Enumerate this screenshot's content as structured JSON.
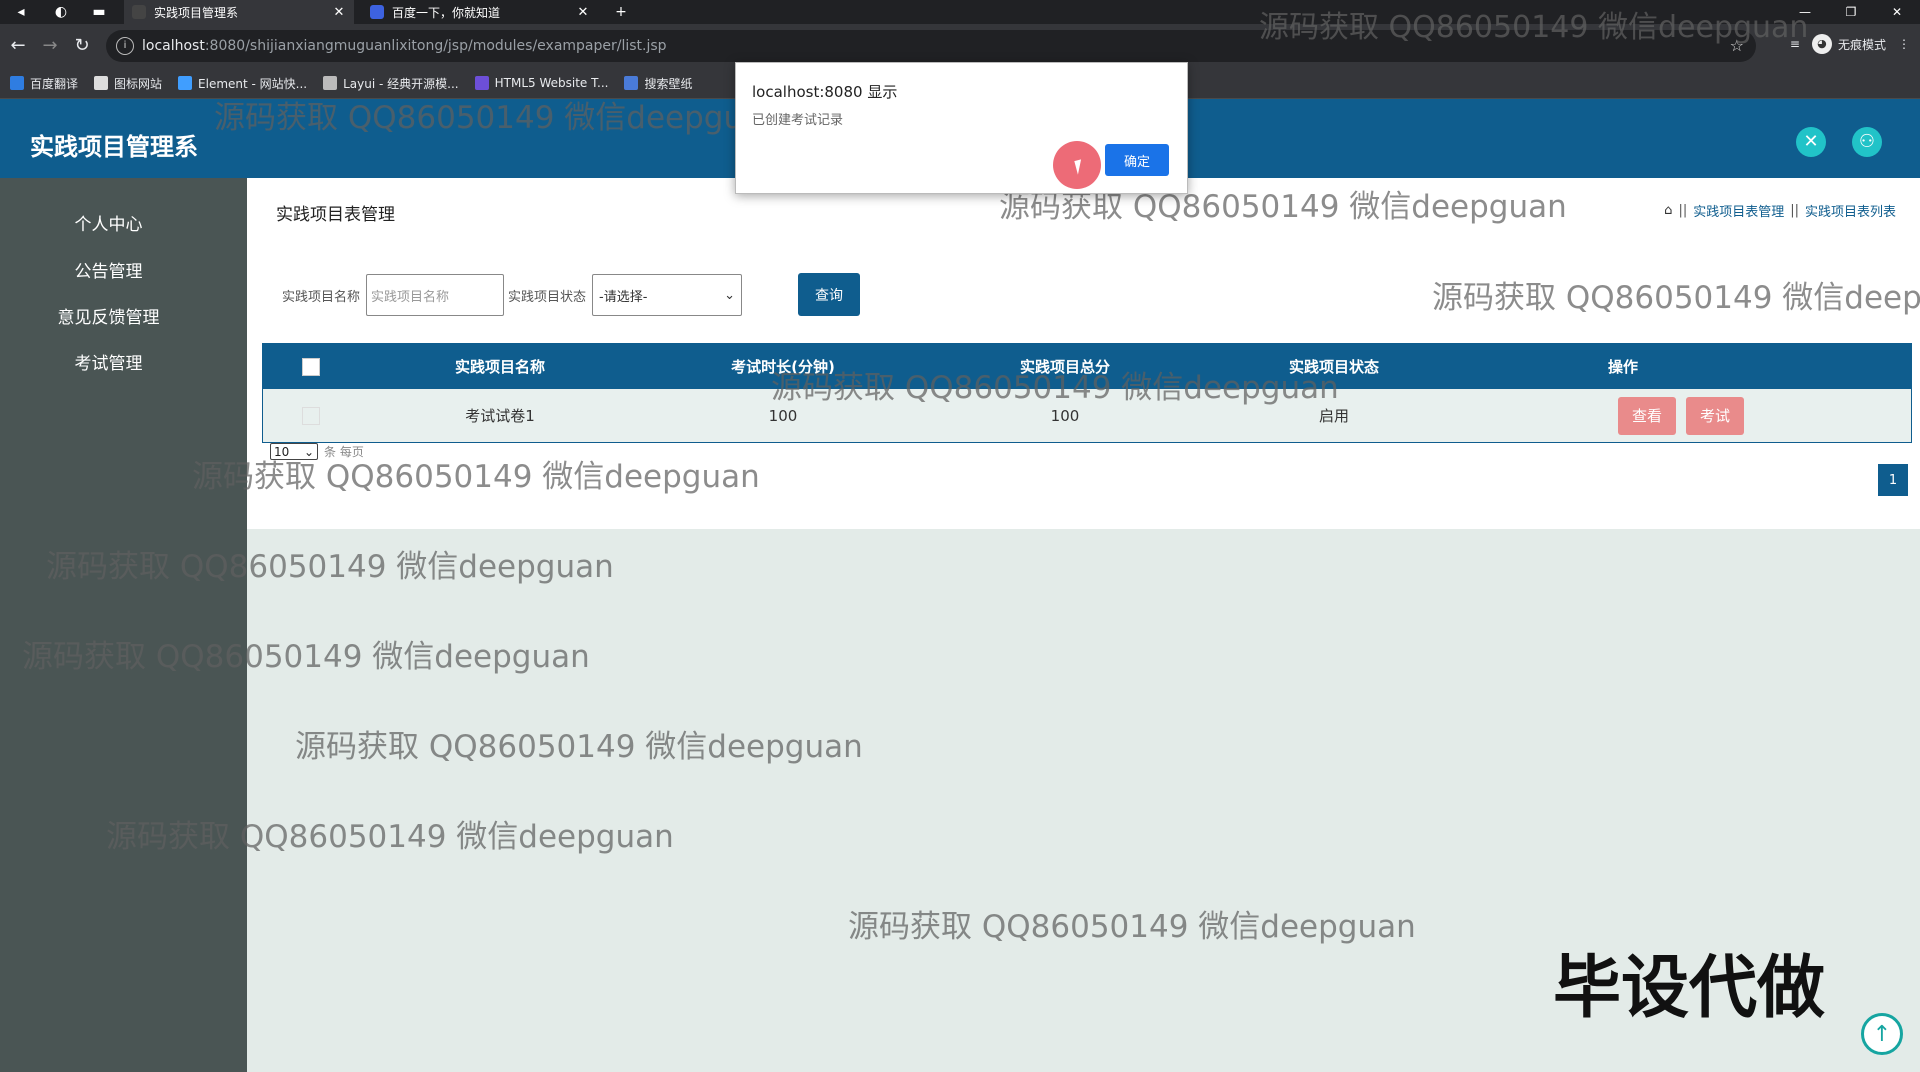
{
  "browser": {
    "tabs": [
      {
        "title": "实践项目管理系",
        "active": true
      },
      {
        "title": "百度一下，你就知道",
        "active": false
      }
    ],
    "url_host": "localhost",
    "url_path": ":8080/shijianxiangmuguanlixitong/jsp/modules/exampaper/list.jsp",
    "incognito_label": "无痕模式",
    "bookmarks": [
      "百度翻译",
      "图标网站",
      "Element - 网站快...",
      "Layui - 经典开源模...",
      "HTML5 Website T...",
      "搜索壁纸"
    ]
  },
  "dialog": {
    "title": "localhost:8080 显示",
    "message": "已创建考试记录",
    "ok_label": "确定"
  },
  "app": {
    "brand": "实践项目管理系",
    "sidebar": [
      "个人中心",
      "公告管理",
      "意见反馈管理",
      "考试管理"
    ],
    "page_title": "实践项目表管理",
    "breadcrumb": [
      "实践项目表管理",
      "实践项目表列表"
    ],
    "search": {
      "name_label": "实践项目名称",
      "name_placeholder": "实践项目名称",
      "status_label": "实践项目状态",
      "status_selected": "-请选择-",
      "query_label": "查询"
    },
    "table": {
      "headers": [
        "实践项目名称",
        "考试时长(分钟)",
        "实践项目总分",
        "实践项目状态",
        "操作"
      ],
      "rows": [
        {
          "name": "考试试卷1",
          "duration": "100",
          "score": "100",
          "status": "启用",
          "view_label": "查看",
          "exam_label": "考试"
        }
      ]
    },
    "pagination": {
      "page_size": "10",
      "page_size_suffix": "条 每页",
      "current_page": "1"
    }
  },
  "watermark_text": "源码获取 QQ86050149 微信deepguan",
  "overlay_text": "毕设代做",
  "colors": {
    "primary": "#0f5d8e",
    "sidebar": "#4a5554",
    "danger_button": "#e98b8b",
    "accent": "#21c3c8"
  }
}
